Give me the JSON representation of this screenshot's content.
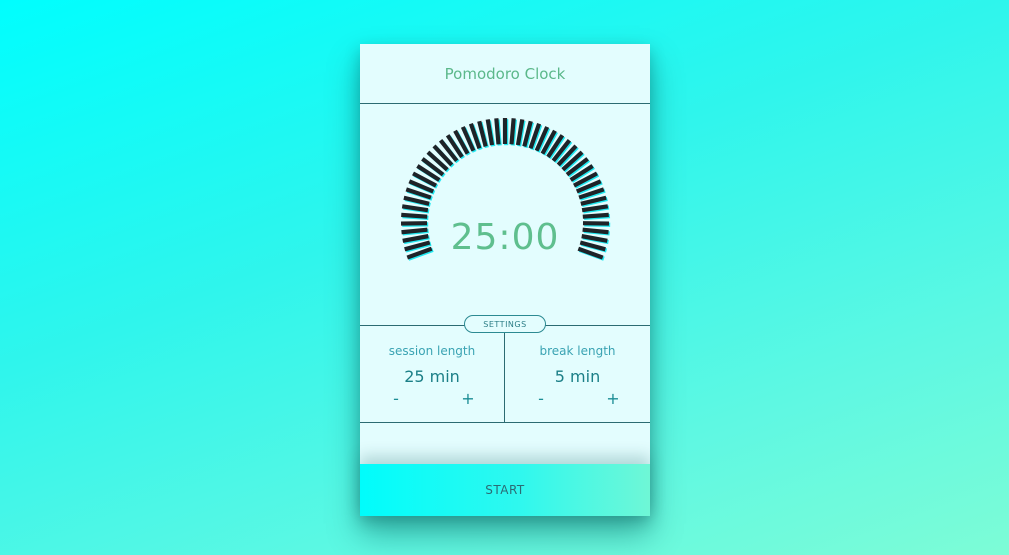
{
  "app": {
    "title": "Pomodoro Clock"
  },
  "timer": {
    "display": "25:00",
    "dial_tick_color": "#1e2328",
    "dial_accent_color": "#20e8f0"
  },
  "settings": {
    "badge_label": "SETTINGS",
    "session": {
      "label": "session length",
      "value": "25 min",
      "decrement_label": "-",
      "increment_label": "+"
    },
    "break": {
      "label": "break length",
      "value": "5 min",
      "decrement_label": "-",
      "increment_label": "+"
    }
  },
  "actions": {
    "start_label": "START"
  },
  "colors": {
    "background_start": "#00fefe",
    "background_end": "#7dfcd6",
    "card_background": "#e3fdfe",
    "title_color": "#5bb88a",
    "time_color": "#5fbf8e"
  }
}
